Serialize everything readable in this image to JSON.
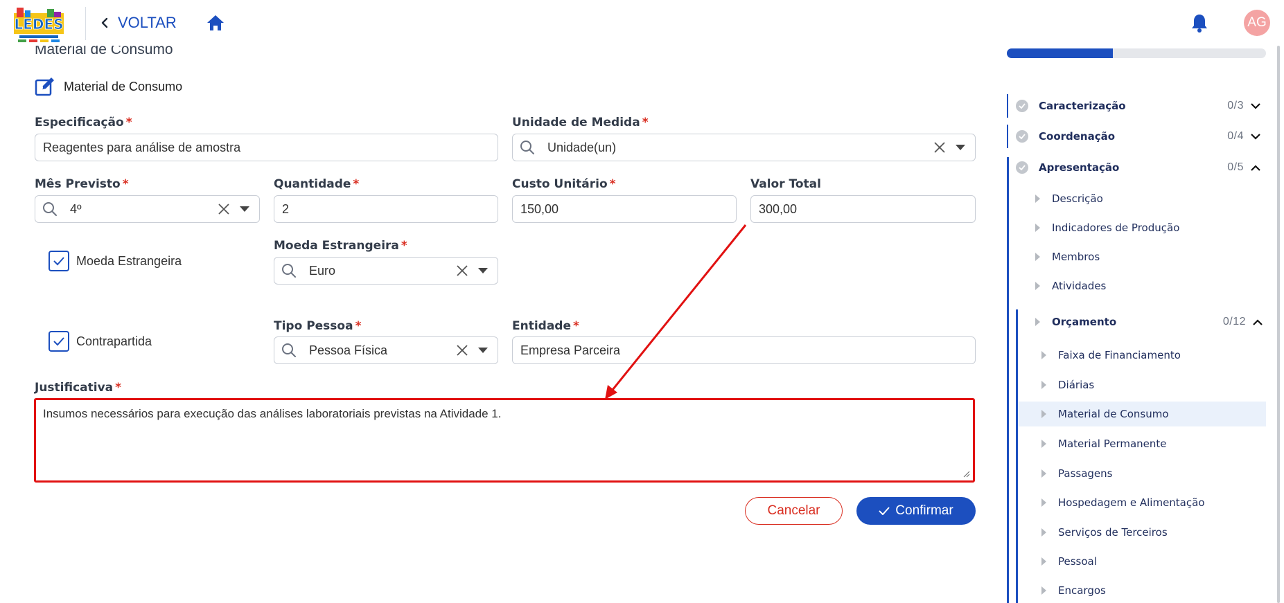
{
  "header": {
    "back_label": "VOLTAR",
    "avatar_initials": "AG",
    "logo_text": "LEDES"
  },
  "form": {
    "section_title": "Material de Consumo",
    "subsection_title": "Material de Consumo",
    "especificacao": {
      "label": "Especificação",
      "value": "Reagentes para análise de amostra"
    },
    "unidade_medida": {
      "label": "Unidade de Medida",
      "value": "Unidade(un)"
    },
    "mes_previsto": {
      "label": "Mês Previsto",
      "value": "4º"
    },
    "quantidade": {
      "label": "Quantidade",
      "value": "2"
    },
    "custo_unitario": {
      "label": "Custo Unitário",
      "value": "150,00"
    },
    "valor_total": {
      "label": "Valor Total",
      "value": "300,00"
    },
    "moeda_estrangeira_checkbox": {
      "label": "Moeda Estrangeira",
      "checked": true
    },
    "moeda_estrangeira": {
      "label": "Moeda Estrangeira",
      "value": "Euro"
    },
    "contrapartida_checkbox": {
      "label": "Contrapartida",
      "checked": true
    },
    "tipo_pessoa": {
      "label": "Tipo Pessoa",
      "value": "Pessoa Física"
    },
    "entidade": {
      "label": "Entidade",
      "value": "Empresa Parceira"
    },
    "justificativa": {
      "label": "Justificativa",
      "value": "Insumos necessários para execução das análises laboratoriais previstas na Atividade 1."
    },
    "required_mark": "*",
    "cancel_label": "Cancelar",
    "confirm_label": "Confirmar"
  },
  "sidebar": {
    "progress_fraction": 0.41,
    "steps": [
      {
        "title": "Caracterização",
        "count": "0/3",
        "expanded": false
      },
      {
        "title": "Coordenação",
        "count": "0/4",
        "expanded": false
      },
      {
        "title": "Apresentação",
        "count": "0/5",
        "expanded": true
      }
    ],
    "apresentacao_items": [
      "Descrição",
      "Indicadores de Produção",
      "Membros",
      "Atividades"
    ],
    "orcamento": {
      "title": "Orçamento",
      "count": "0/12"
    },
    "orcamento_items": [
      "Faixa de Financiamento",
      "Diárias",
      "Material de Consumo",
      "Material Permanente",
      "Passagens",
      "Hospedagem e Alimentação",
      "Serviços de Terceiros",
      "Pessoal",
      "Encargos"
    ],
    "active_item": "Material de Consumo"
  },
  "colors": {
    "primary": "#1c4fbf",
    "danger": "#d92d20",
    "highlight": "#e11111"
  }
}
